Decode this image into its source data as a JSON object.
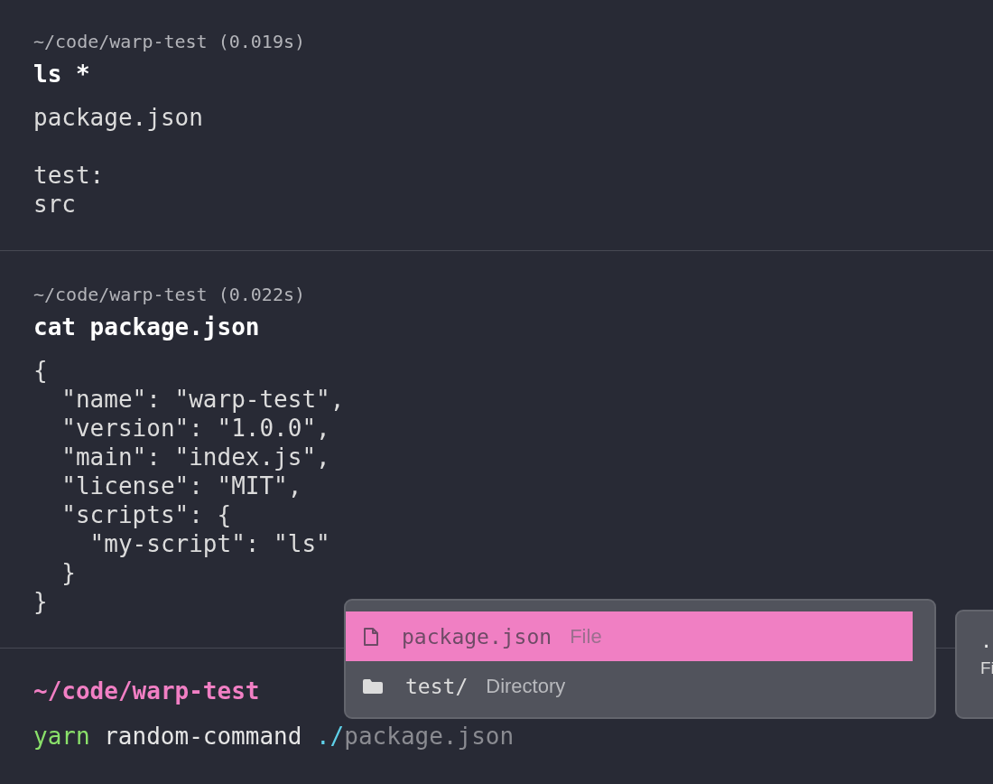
{
  "blocks": [
    {
      "header": "~/code/warp-test (0.019s)",
      "command": "ls *",
      "output": "package.json\n\ntest:\nsrc"
    },
    {
      "header": "~/code/warp-test (0.022s)",
      "command": "cat package.json",
      "output": "{\n  \"name\": \"warp-test\",\n  \"version\": \"1.0.0\",\n  \"main\": \"index.js\",\n  \"license\": \"MIT\",\n  \"scripts\": {\n    \"my-script\": \"ls\"\n  }\n}"
    }
  ],
  "prompt": {
    "path": "~/code/warp-test",
    "input": [
      {
        "kind": "command",
        "text": "yarn"
      },
      {
        "kind": "plain",
        "text": "random-command"
      },
      {
        "kind": "path",
        "text": "./"
      },
      {
        "kind": "suggestion",
        "text": "package.json"
      }
    ]
  },
  "completions": [
    {
      "kind": "file",
      "name": "package.json",
      "type": "File",
      "selected": true
    },
    {
      "kind": "directory",
      "name": "test/",
      "type": "Directory",
      "selected": false
    }
  ],
  "side_card": {
    "title": ".",
    "subtitle": "Fi"
  }
}
